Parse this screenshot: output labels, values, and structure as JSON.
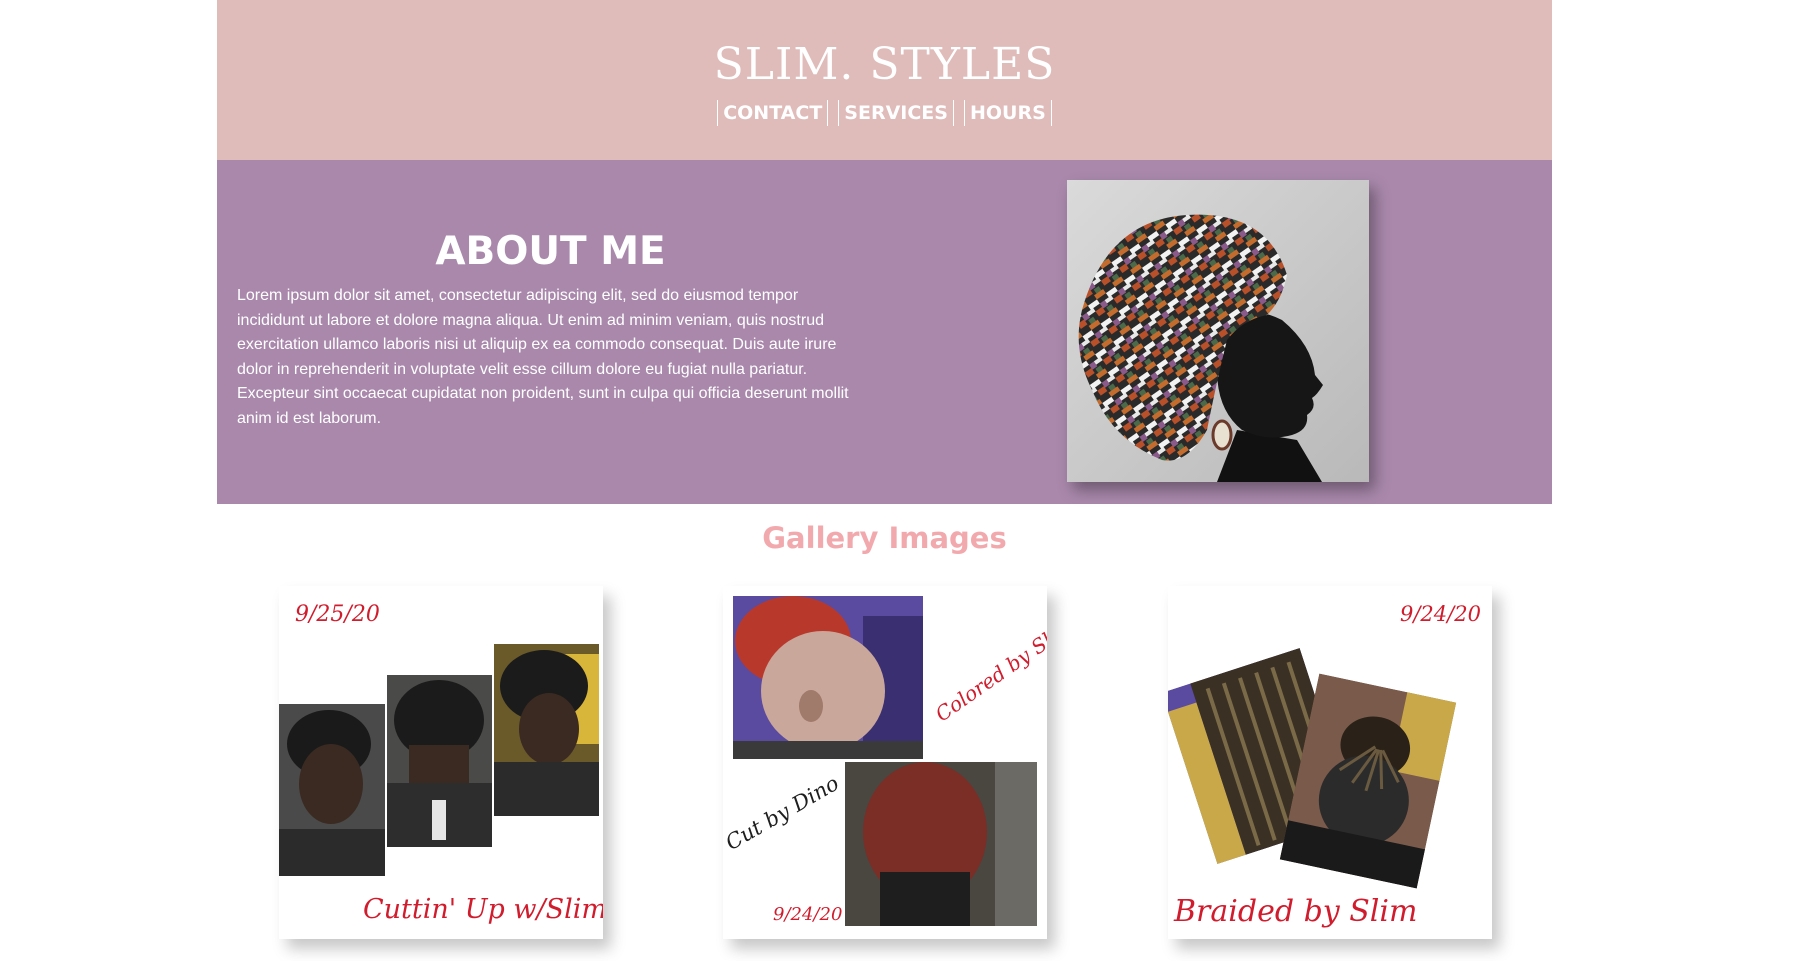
{
  "header": {
    "brand": "SLIM. STYLES",
    "nav": [
      "CONTACT",
      "SERVICES",
      "HOURS"
    ]
  },
  "about": {
    "title": "ABOUT ME",
    "body": "Lorem ipsum dolor sit amet, consectetur adipiscing elit, sed do eiusmod tempor incididunt ut labore et dolore magna aliqua. Ut enim ad minim veniam, quis nostrud exercitation ullamco laboris nisi ut aliquip ex ea commodo consequat. Duis aute irure dolor in reprehenderit in voluptate velit esse cillum dolore eu fugiat nulla pariatur. Excepteur sint occaecat cupidatat non proident, sunt in culpa qui officia deserunt mollit anim id est laborum."
  },
  "gallery": {
    "title": "Gallery Images",
    "cards": [
      {
        "date": "9/25/20",
        "caption": "Cuttin' Up w/Slim"
      },
      {
        "date": "9/24/20",
        "caption": "Colored by Slim",
        "caption2": "Cut by Dino"
      },
      {
        "date": "9/24/20",
        "caption": "Braided by Slim"
      }
    ]
  },
  "colors": {
    "header_bg": "#dfbbba",
    "about_bg": "#a988ac",
    "gallery_title": "#f2a9ad",
    "caption_red": "#d01c2c"
  }
}
